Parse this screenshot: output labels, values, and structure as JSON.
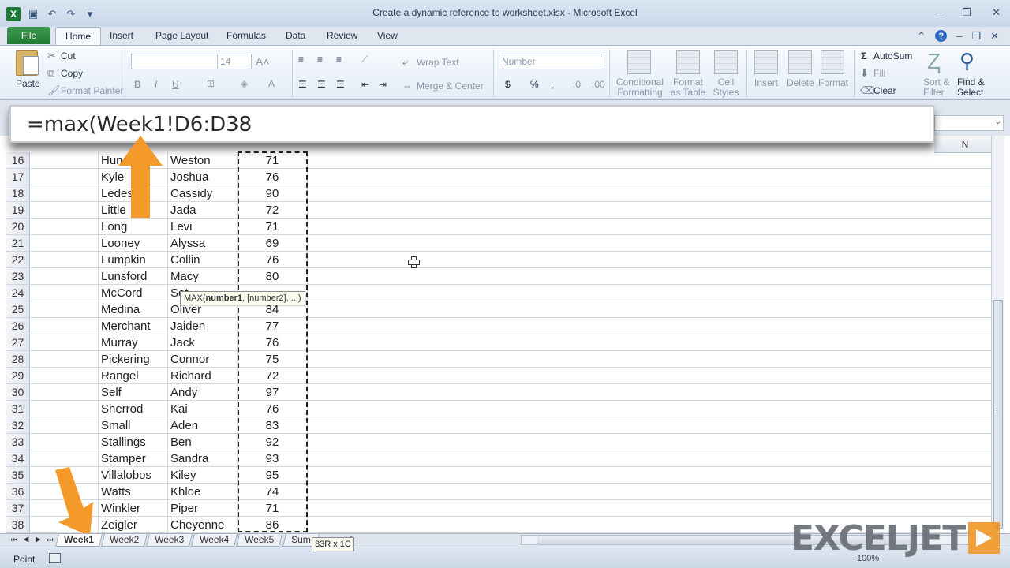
{
  "window": {
    "title": "Create a dynamic reference to worksheet.xlsx - Microsoft Excel"
  },
  "ribbon_tabs": [
    "File",
    "Home",
    "Insert",
    "Page Layout",
    "Formulas",
    "Data",
    "Review",
    "View"
  ],
  "ribbon": {
    "clipboard": {
      "paste": "Paste",
      "cut": "Cut",
      "copy": "Copy",
      "format_painter": "Format Painter"
    },
    "font": {
      "size": "14"
    },
    "alignment": {
      "wrap_text": "Wrap Text",
      "merge_center": "Merge & Center"
    },
    "number": {
      "format": "Number"
    },
    "styles": {
      "conditional_formatting": [
        "Conditional",
        "Formatting"
      ],
      "format_as_table": [
        "Format",
        "as Table"
      ],
      "cell_styles": [
        "Cell",
        "Styles"
      ]
    },
    "cells": {
      "insert": "Insert",
      "delete": "Delete",
      "format": "Format"
    },
    "editing": {
      "autosum": "AutoSum",
      "fill": "Fill",
      "clear": "Clear",
      "sort_filter": [
        "Sort &",
        "Filter"
      ],
      "find_select": [
        "Find &",
        "Select"
      ]
    }
  },
  "formula_bar": {
    "formula": "=max(Week1!D6:D38"
  },
  "column_header_visible": "N",
  "rows": [
    {
      "num": "16",
      "last": "Hun",
      "first": "Weston",
      "score": "71"
    },
    {
      "num": "17",
      "last": "Kyle",
      "first": "Joshua",
      "score": "76"
    },
    {
      "num": "18",
      "last": "Ledes",
      "first": "Cassidy",
      "score": "90"
    },
    {
      "num": "19",
      "last": "Little",
      "first": "Jada",
      "score": "72"
    },
    {
      "num": "20",
      "last": "Long",
      "first": "Levi",
      "score": "71"
    },
    {
      "num": "21",
      "last": "Looney",
      "first": "Alyssa",
      "score": "69"
    },
    {
      "num": "22",
      "last": "Lumpkin",
      "first": "Collin",
      "score": "76"
    },
    {
      "num": "23",
      "last": "Lunsford",
      "first": "Macy",
      "score": "80"
    },
    {
      "num": "24",
      "last": "McCord",
      "first": "Set",
      "score": ""
    },
    {
      "num": "25",
      "last": "Medina",
      "first": "Oliver",
      "score": "84"
    },
    {
      "num": "26",
      "last": "Merchant",
      "first": "Jaiden",
      "score": "77"
    },
    {
      "num": "27",
      "last": "Murray",
      "first": "Jack",
      "score": "76"
    },
    {
      "num": "28",
      "last": "Pickering",
      "first": "Connor",
      "score": "75"
    },
    {
      "num": "29",
      "last": "Rangel",
      "first": "Richard",
      "score": "72"
    },
    {
      "num": "30",
      "last": "Self",
      "first": "Andy",
      "score": "97"
    },
    {
      "num": "31",
      "last": "Sherrod",
      "first": "Kai",
      "score": "76"
    },
    {
      "num": "32",
      "last": "Small",
      "first": "Aden",
      "score": "83"
    },
    {
      "num": "33",
      "last": "Stallings",
      "first": "Ben",
      "score": "92"
    },
    {
      "num": "34",
      "last": "Stamper",
      "first": "Sandra",
      "score": "93"
    },
    {
      "num": "35",
      "last": "Villalobos",
      "first": "Kiley",
      "score": "95"
    },
    {
      "num": "36",
      "last": "Watts",
      "first": "Khloe",
      "score": "74"
    },
    {
      "num": "37",
      "last": "Winkler",
      "first": "Piper",
      "score": "71"
    },
    {
      "num": "38",
      "last": "Zeigler",
      "first": "Cheyenne",
      "score": "86"
    }
  ],
  "tooltip": {
    "fn": "MAX(",
    "arg1": "number1",
    "rest": ", [number2], ...)"
  },
  "sheet_tabs": [
    "Week1",
    "Week2",
    "Week3",
    "Week4",
    "Week5",
    "Sum"
  ],
  "active_sheet": "Week1",
  "selection_size": "33R x 1C",
  "status": {
    "mode": "Point",
    "zoom": "100%"
  },
  "watermark": {
    "text": "EXCELJET"
  },
  "colors": {
    "accent_orange": "#f39a2b",
    "excel_green": "#217a33"
  }
}
